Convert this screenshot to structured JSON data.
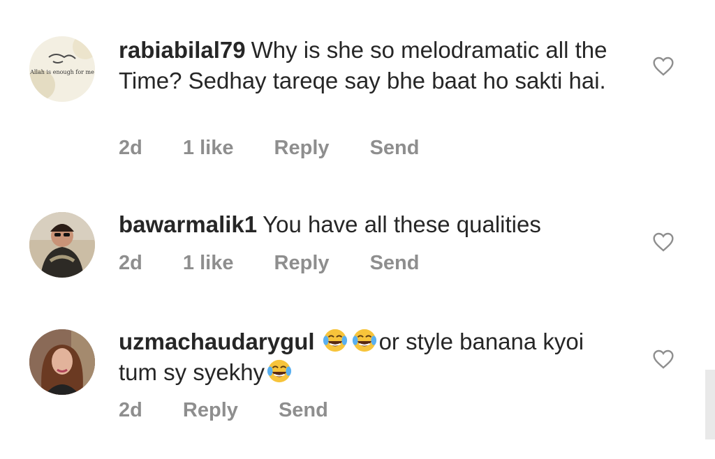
{
  "comments": [
    {
      "username": "rabiabilal79",
      "text": "Why is she so melodramatic all the Time? Sedhay tareqe say bhe baat ho sakti hai.",
      "time": "2d",
      "likes": "1 like",
      "reply_label": "Reply",
      "send_label": "Send",
      "avatar_text": "Allah is enough for me"
    },
    {
      "username": "bawarmalik1",
      "text": "You have all these qualities",
      "time": "2d",
      "likes": "1 like",
      "reply_label": "Reply",
      "send_label": "Send"
    },
    {
      "username": "uzmachaudarygul",
      "text_part2": "or style banana kyoi tum sy syekhy",
      "time": "2d",
      "reply_label": "Reply",
      "send_label": "Send",
      "emojis": [
        "face-with-tears-of-joy",
        "face-with-tears-of-joy",
        "face-with-tears-of-joy"
      ]
    }
  ],
  "icons": {
    "like": "heart-outline-icon"
  },
  "colors": {
    "text": "#262626",
    "meta": "#8e8e8e",
    "heart": "#8e8e8e"
  }
}
